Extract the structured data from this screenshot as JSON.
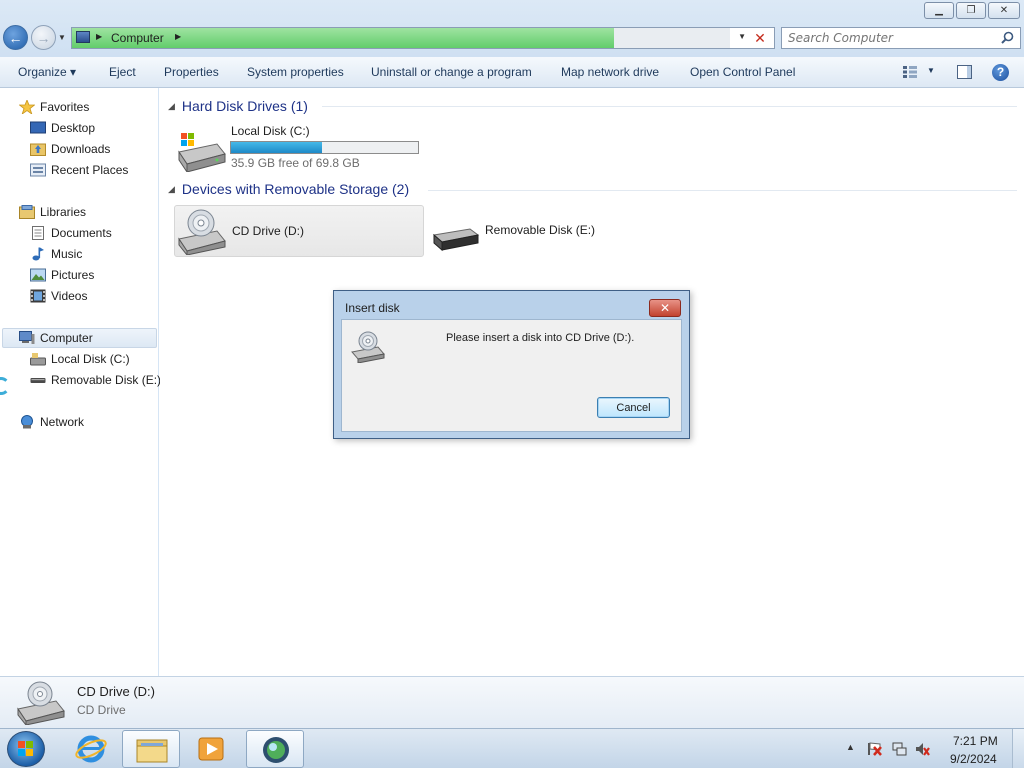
{
  "window": {
    "address_path": "Computer",
    "search_placeholder": "Search Computer",
    "buttons": {
      "minimize_icon": "minimize-icon",
      "maximize_icon": "restore-icon",
      "close_icon": "close-icon"
    }
  },
  "toolbar": {
    "organize": "Organize ▾",
    "eject": "Eject",
    "properties": "Properties",
    "system_properties": "System properties",
    "uninstall": "Uninstall or change a program",
    "map_drive": "Map network drive",
    "control_panel": "Open Control Panel"
  },
  "sidebar": {
    "favorites": "Favorites",
    "desktop": "Desktop",
    "downloads": "Downloads",
    "recent": "Recent Places",
    "libraries": "Libraries",
    "documents": "Documents",
    "music": "Music",
    "pictures": "Pictures",
    "videos": "Videos",
    "computer": "Computer",
    "local_disk": "Local Disk (C:)",
    "removable": "Removable Disk (E:)",
    "network": "Network"
  },
  "content": {
    "hdd_header": "Hard Disk Drives (1)",
    "removable_header": "Devices with Removable Storage (2)",
    "local_disk": {
      "name": "Local Disk (C:)",
      "free": "35.9 GB free of 69.8 GB",
      "used_fraction": 0.486
    },
    "cd_drive": {
      "name": "CD Drive (D:)"
    },
    "removable_disk": {
      "name": "Removable Disk (E:)"
    }
  },
  "dialog": {
    "title": "Insert disk",
    "message": "Please insert a disk into CD Drive (D:).",
    "cancel": "Cancel"
  },
  "details": {
    "name": "CD Drive (D:)",
    "type": "CD Drive"
  },
  "taskbar": {
    "time": "7:21 PM",
    "date": "9/2/2024",
    "active_app": "explorer"
  },
  "colors": {
    "address_progress": "#62cd6b",
    "group_header": "#1e3287",
    "disk_bar": "#1e8ac8"
  }
}
